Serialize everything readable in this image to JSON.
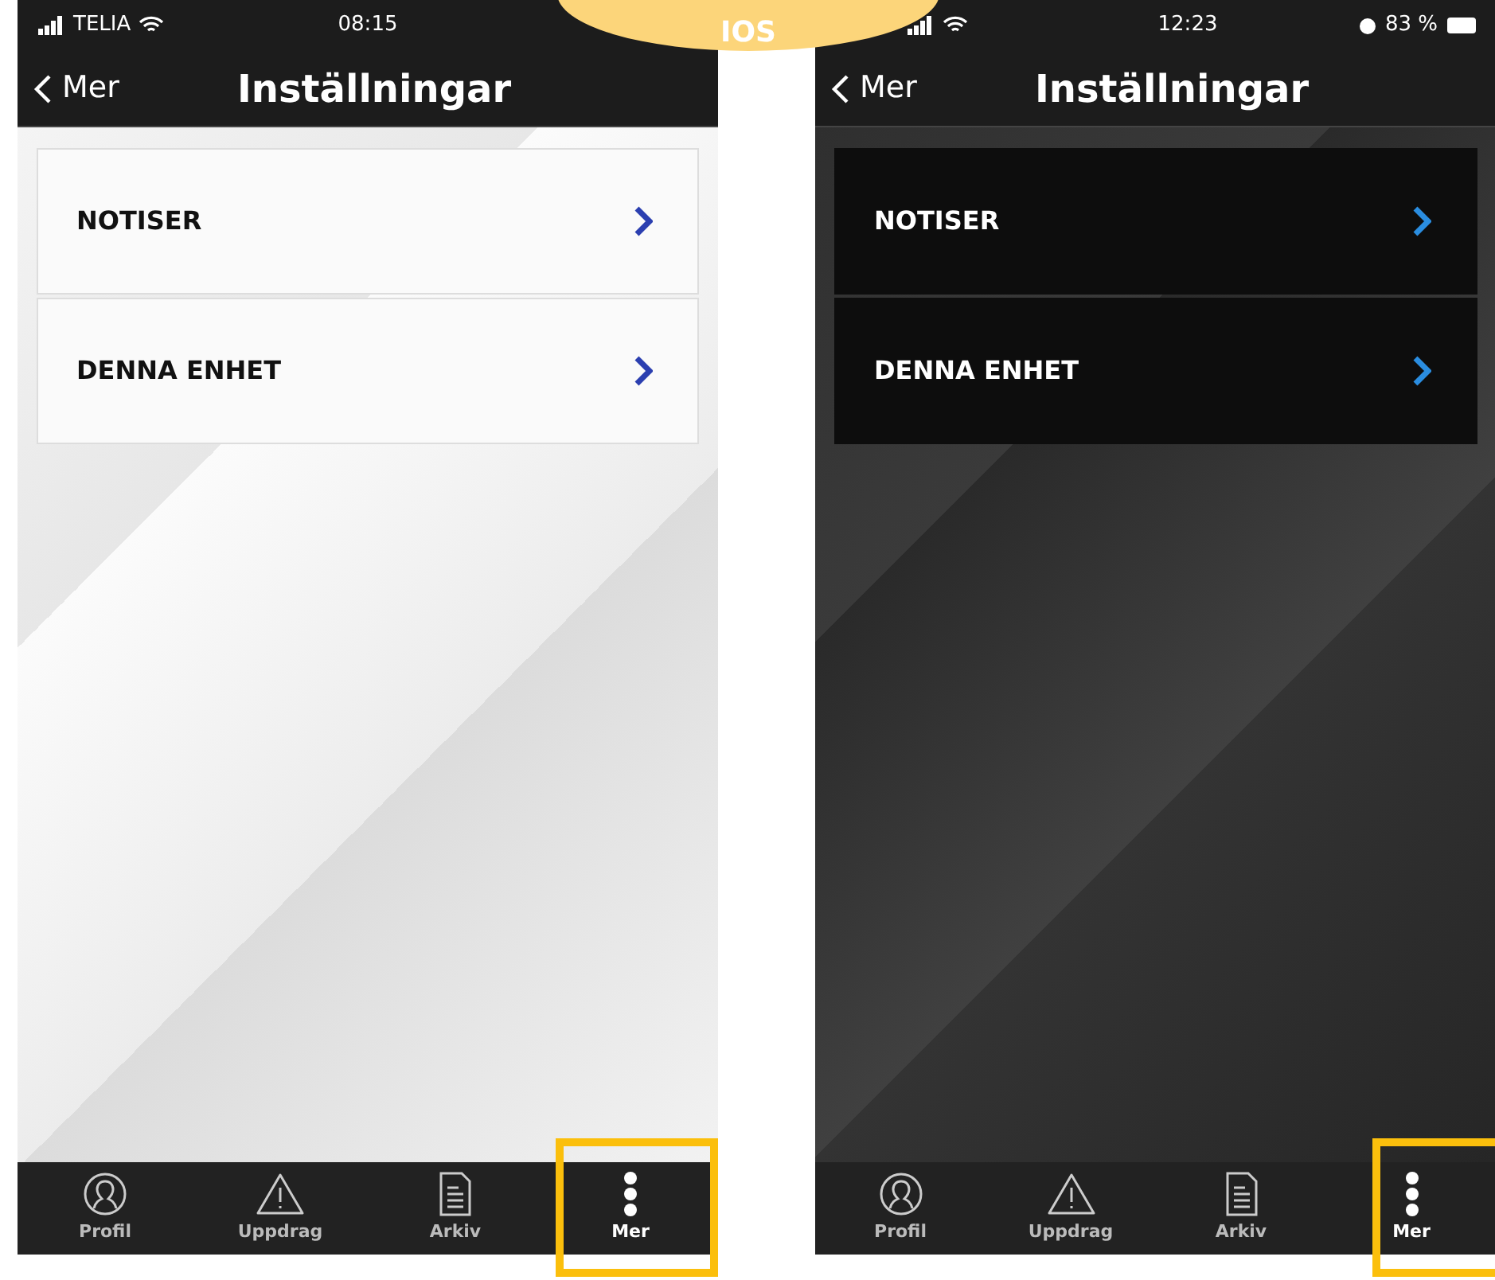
{
  "banner": {
    "label": "IOS"
  },
  "screens": [
    {
      "kind": "light",
      "status_bar": {
        "carrier": "TELIA",
        "time": "08:15"
      },
      "nav": {
        "back": "Mer",
        "title": "Inställningar"
      },
      "items": [
        {
          "label": "NOTISER"
        },
        {
          "label": "DENNA ENHET"
        }
      ],
      "tabs": [
        {
          "label": "Profil",
          "kind": "person",
          "selected": false,
          "highlighted": false
        },
        {
          "label": "Uppdrag",
          "kind": "warning",
          "selected": false,
          "highlighted": false
        },
        {
          "label": "Arkiv",
          "kind": "document",
          "selected": false,
          "highlighted": false
        },
        {
          "label": "Mer",
          "kind": "more",
          "selected": true,
          "highlighted": true
        }
      ]
    },
    {
      "kind": "dark",
      "status_bar": {
        "time": "12:23",
        "battery": "83 %"
      },
      "nav": {
        "back": "Mer",
        "title": "Inställningar"
      },
      "items": [
        {
          "label": "NOTISER"
        },
        {
          "label": "DENNA ENHET"
        }
      ],
      "tabs": [
        {
          "label": "Profil",
          "kind": "person",
          "selected": false,
          "highlighted": false
        },
        {
          "label": "Uppdrag",
          "kind": "warning",
          "selected": false,
          "highlighted": false
        },
        {
          "label": "Arkiv",
          "kind": "document",
          "selected": false,
          "highlighted": false
        },
        {
          "label": "Mer",
          "kind": "more",
          "selected": true,
          "highlighted": true
        }
      ]
    }
  ]
}
